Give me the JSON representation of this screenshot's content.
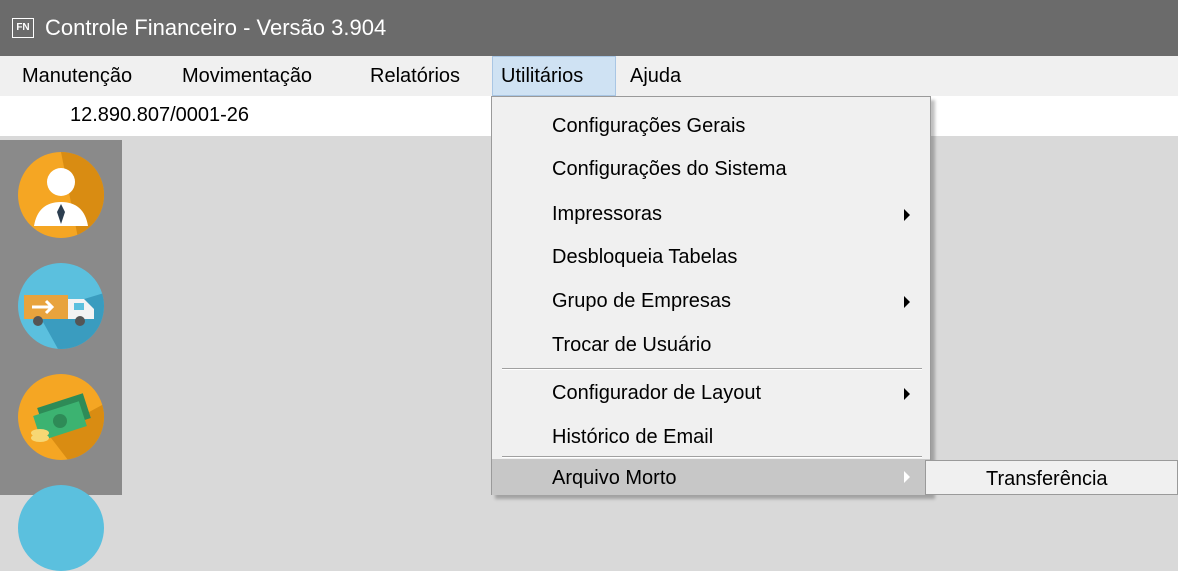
{
  "window": {
    "app_icon_text": "FN",
    "title": "Controle Financeiro - Versão 3.904"
  },
  "menubar": {
    "items": [
      {
        "label": "Manutenção"
      },
      {
        "label": "Movimentação"
      },
      {
        "label": "Relatórios"
      },
      {
        "label": "Utilitários",
        "active": true
      },
      {
        "label": "Ajuda"
      }
    ]
  },
  "info": {
    "cnpj": "12.890.807/0001-26"
  },
  "left_panel": {
    "icons": [
      "user-tie-icon",
      "delivery-truck-icon",
      "money-bills-icon"
    ],
    "colors": [
      "#f5a623",
      "#5bc0de",
      "#f5a623"
    ]
  },
  "utilitarios_menu": {
    "items": [
      {
        "label": "Configurações Gerais",
        "submenu": false
      },
      {
        "label": "Configurações do Sistema",
        "submenu": false
      },
      {
        "label": "Impressoras",
        "submenu": true
      },
      {
        "label": "Desbloqueia Tabelas",
        "submenu": false
      },
      {
        "label": "Grupo de Empresas",
        "submenu": true
      },
      {
        "label": "Trocar de Usuário",
        "submenu": false
      },
      {
        "label": "Configurador de Layout",
        "submenu": true
      },
      {
        "label": "Histórico de Email",
        "submenu": false
      },
      {
        "label": "Arquivo Morto",
        "submenu": true,
        "highlighted": true
      }
    ]
  },
  "arquivo_morto_submenu": {
    "items": [
      {
        "label": "Transferência"
      }
    ]
  }
}
